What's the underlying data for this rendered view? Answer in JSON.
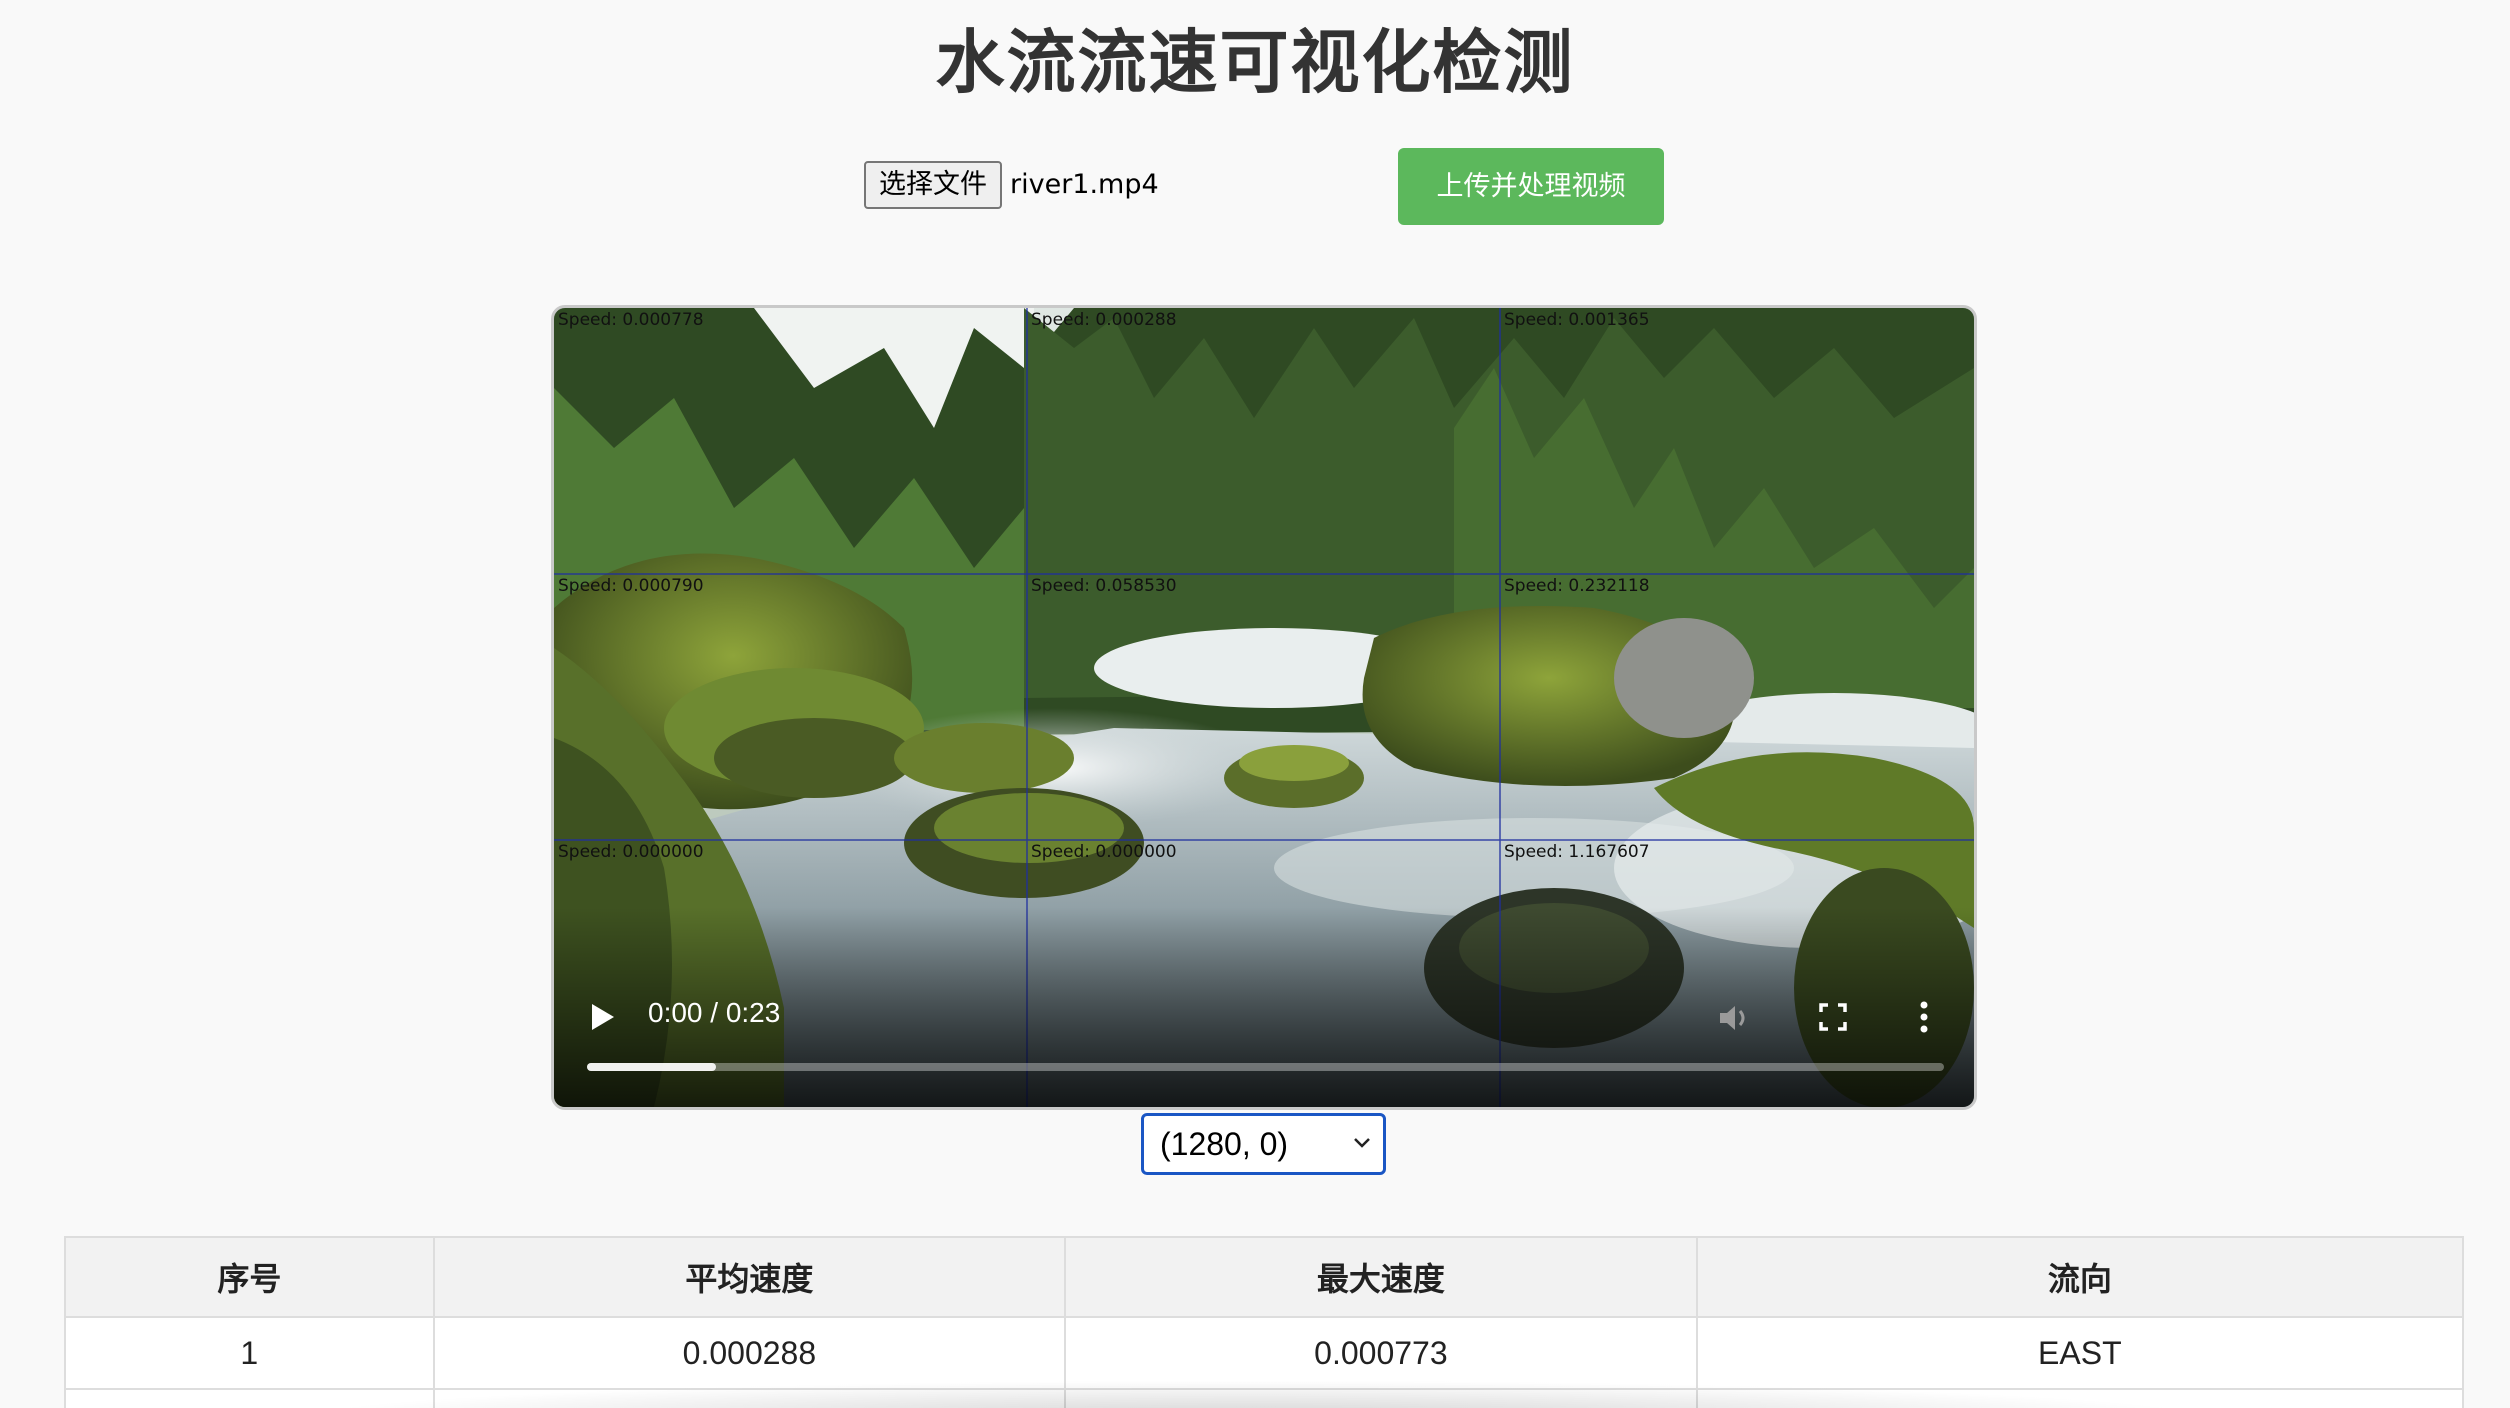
{
  "page": {
    "title": "水流流速可视化检测"
  },
  "upload": {
    "file_button_label": "选择文件",
    "file_name": "river1.mp4",
    "upload_button_label": "上传并处理视频"
  },
  "video": {
    "speed_labels": [
      {
        "text": "Speed: 0.000778"
      },
      {
        "text": "Speed: 0.000288"
      },
      {
        "text": "Speed: 0.001365"
      },
      {
        "text": "Speed: 0.000790"
      },
      {
        "text": "Speed: 0.058530"
      },
      {
        "text": "Speed: 0.232118"
      },
      {
        "text": "Speed: 0.000000"
      },
      {
        "text": "Speed: 0.000000"
      },
      {
        "text": "Speed: 1.167607"
      }
    ],
    "time_display": "0:00 / 0:23",
    "progress": 0.095,
    "icons": {
      "play": "play-icon",
      "volume": "volume-icon",
      "fullscreen": "fullscreen-icon",
      "more": "more-options-icon"
    }
  },
  "region_select": {
    "selected": "(1280, 0)"
  },
  "table": {
    "headers": [
      "序号",
      "平均速度",
      "最大速度",
      "流向"
    ],
    "rows": [
      [
        "1",
        "0.000288",
        "0.000773",
        "EAST"
      ],
      [
        "",
        "",
        "",
        ""
      ]
    ]
  },
  "colors": {
    "upload_button": "#5cb85c",
    "select_border": "#1a56c4",
    "grid_lines": "#1f2fa0"
  }
}
